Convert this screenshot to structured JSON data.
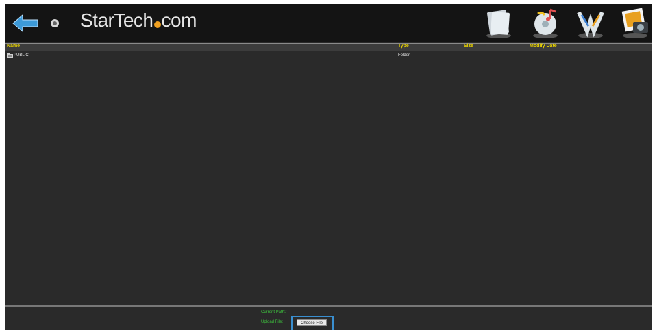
{
  "header": {
    "logo_text_pre": "StarTech",
    "logo_text_post": "com",
    "icons": [
      "back-arrow-icon",
      "home-icon",
      "documents-icon",
      "music-icon",
      "video-icon",
      "photos-icon"
    ]
  },
  "columns": {
    "name": "Name",
    "type": "Type",
    "size": "Size",
    "modify_date": "Modify Date"
  },
  "rows": [
    {
      "name": "PUBLIC",
      "type": "Folder",
      "size": "",
      "modify_date": "-"
    }
  ],
  "footer": {
    "line1": "Current Path:/",
    "line2": "Upload File:",
    "choose_file_label": "Choose File"
  },
  "colors": {
    "accent_yellow": "#e8d200",
    "status_green": "#3ec43e",
    "panel_bg": "#2a2a2a",
    "header_bg": "#141414",
    "upload_border": "#3a8fd0"
  }
}
